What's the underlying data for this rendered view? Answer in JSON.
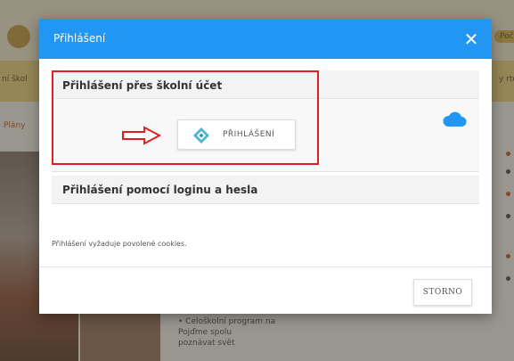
{
  "dialog": {
    "title": "Přihlášení",
    "close_symbol": "✕",
    "school_account_section": {
      "title": "Přihlášení přes školní účet",
      "login_button_label": "PŘIHLÁŠENÍ"
    },
    "login_password_section": {
      "title": "Přihlášení pomocí loginu a hesla"
    },
    "cookies_note": "Přihlášení vyžaduje povolené cookies.",
    "cancel_button_label": "STORNO"
  },
  "background": {
    "menu_left": "ní škol",
    "menu_right": "y rto",
    "corner_label": "Poč",
    "side_title": "Plány",
    "list_items": [
      "• Celoškolní program na",
      "  Pojďme spolu",
      "  poznávat svět"
    ]
  },
  "colors": {
    "header": "#2196f3",
    "highlight_frame": "#e02020",
    "arrow": "#e02020",
    "cloud": "#2196f3"
  },
  "icons": {
    "close": "close-icon",
    "arrow": "arrow-right-icon",
    "login_logo": "diamond-logo-icon",
    "cloud": "cloud-icon"
  }
}
